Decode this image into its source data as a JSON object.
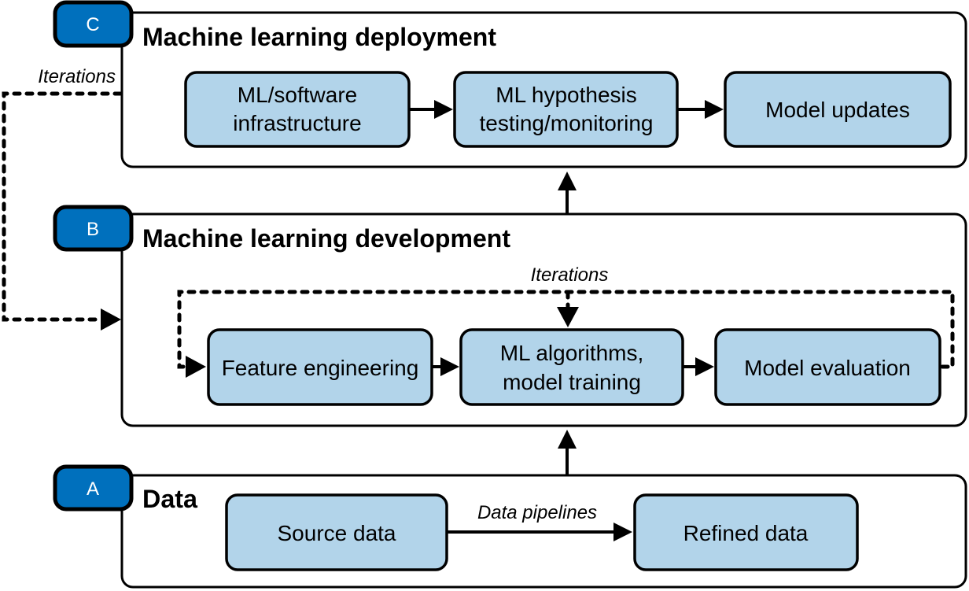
{
  "colors": {
    "badge": "#0070BD",
    "box": "#B2D4EA"
  },
  "deployment": {
    "badge": "C",
    "title": "Machine learning deployment",
    "iterations_label": "Iterations",
    "steps": [
      [
        "ML/software",
        "infrastructure"
      ],
      [
        "ML hypothesis",
        "testing/monitoring"
      ],
      [
        "Model updates"
      ]
    ]
  },
  "development": {
    "badge": "B",
    "title": "Machine learning development",
    "iterations_label": "Iterations",
    "steps": [
      [
        "Feature engineering"
      ],
      [
        "ML algorithms,",
        "model training"
      ],
      [
        "Model evaluation"
      ]
    ]
  },
  "data": {
    "badge": "A",
    "title": "Data",
    "pipeline_label": "Data pipelines",
    "steps": [
      [
        "Source data"
      ],
      [
        "Refined data"
      ]
    ]
  }
}
